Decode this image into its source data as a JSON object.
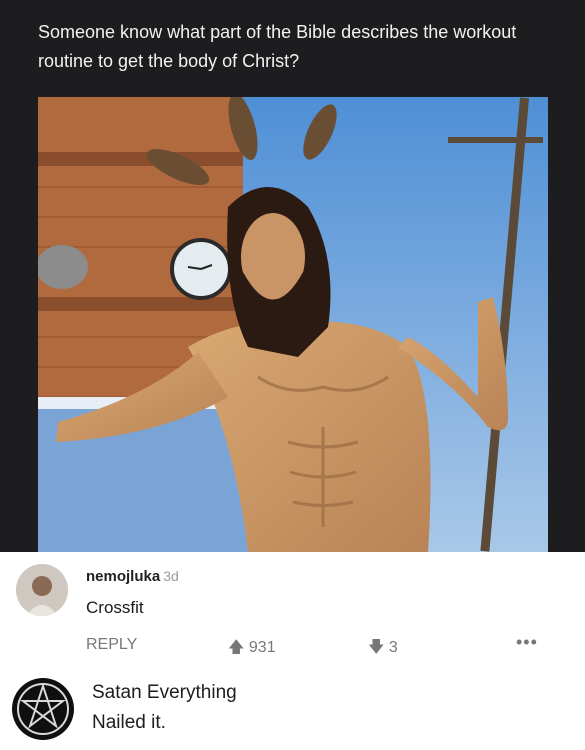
{
  "post": {
    "title": "Someone know what part of the Bible describes the workout routine to get the body of Christ?",
    "image_icon": "statue-photo"
  },
  "comments": [
    {
      "username": "nemojluka",
      "age": "3d",
      "text": "Crossfit",
      "reply_label": "REPLY",
      "upvotes": "931",
      "downvotes": "3",
      "more_label": "•••",
      "upvote_icon": "arrow-up-icon",
      "downvote_icon": "arrow-down-icon"
    },
    {
      "username": "Satan Everything",
      "text": "Nailed it.",
      "avatar_icon": "pentagram-icon"
    }
  ]
}
